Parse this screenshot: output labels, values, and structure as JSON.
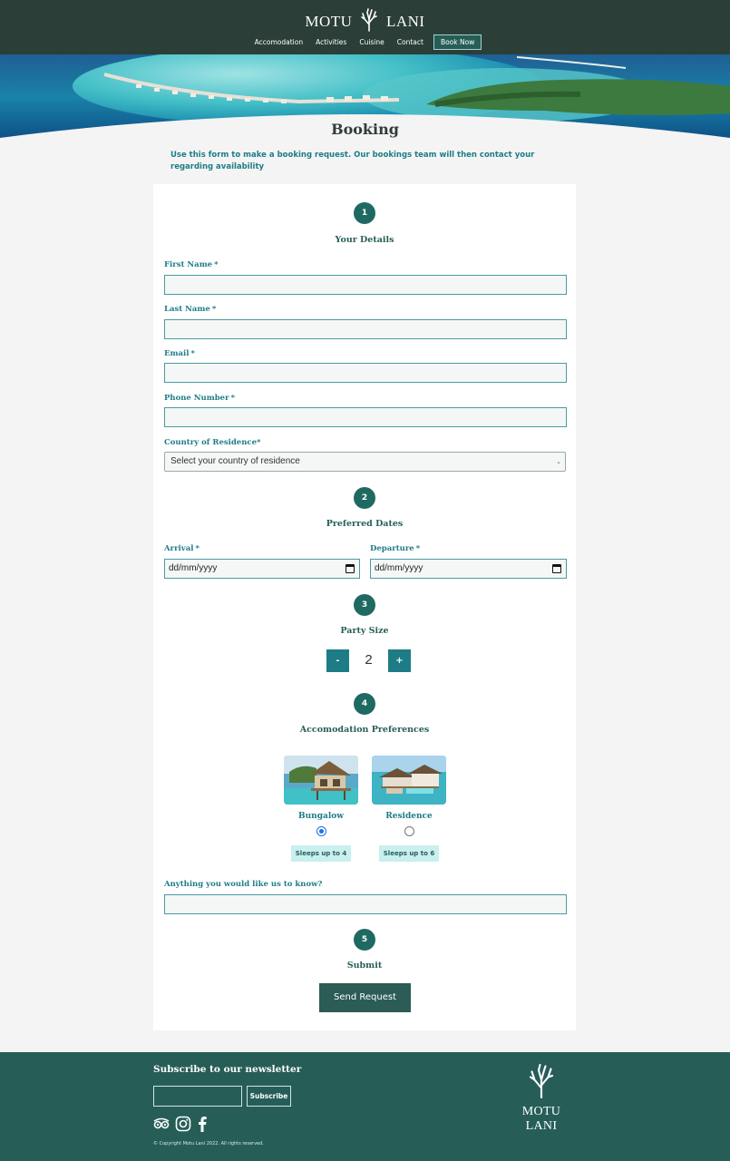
{
  "header": {
    "brand_left": "MOTU",
    "brand_right": "LANI",
    "nav": [
      "Accomodation",
      "Activities",
      "Cuisine",
      "Contact"
    ],
    "book_now": "Book Now"
  },
  "page": {
    "title": "Booking",
    "intro": "Use this form to make a booking request. Our bookings team will then contact your regarding availability"
  },
  "form": {
    "steps": [
      {
        "number": "1",
        "title": "Your Details"
      },
      {
        "number": "2",
        "title": "Preferred Dates"
      },
      {
        "number": "3",
        "title": "Party Size"
      },
      {
        "number": "4",
        "title": "Accomodation Preferences"
      },
      {
        "number": "5",
        "title": "Submit"
      }
    ],
    "required_mark": "*",
    "fields": {
      "first_name": {
        "label": "First Name",
        "value": ""
      },
      "last_name": {
        "label": "Last Name",
        "value": ""
      },
      "email": {
        "label": "Email",
        "value": ""
      },
      "phone": {
        "label": "Phone Number",
        "value": ""
      },
      "country": {
        "label": "Country of Residence",
        "selected": "Select your country of residence"
      },
      "arrival": {
        "label": "Arrival",
        "value": "dd/mm/yyyy"
      },
      "departure": {
        "label": "Departure",
        "value": "dd/mm/yyyy"
      }
    },
    "party_size": {
      "minus": "-",
      "value": "2",
      "plus": "+"
    },
    "accommodation": [
      {
        "name": "Bungalow",
        "sleeps": "Sleeps up to 4",
        "selected": true
      },
      {
        "name": "Residence",
        "sleeps": "Sleeps up to 6",
        "selected": false
      }
    ],
    "notes": {
      "label": "Anything you would like us to know?",
      "value": ""
    },
    "submit_label": "Send Request"
  },
  "footer": {
    "newsletter_title": "Subscribe to our newsletter",
    "email_value": "",
    "subscribe_label": "Subscribe",
    "social_icons": [
      "tripadvisor-icon",
      "instagram-icon",
      "facebook-icon"
    ],
    "copyright": "Copyright Motu Lani 2022. All rights reserved.",
    "brand": "MOTU LANI"
  },
  "colors": {
    "header_bg": "#2b3e38",
    "accent": "#1d7c86",
    "step_circle": "#1e6a62",
    "footer_bg": "#265e57",
    "badge_bg": "#c9efef"
  }
}
